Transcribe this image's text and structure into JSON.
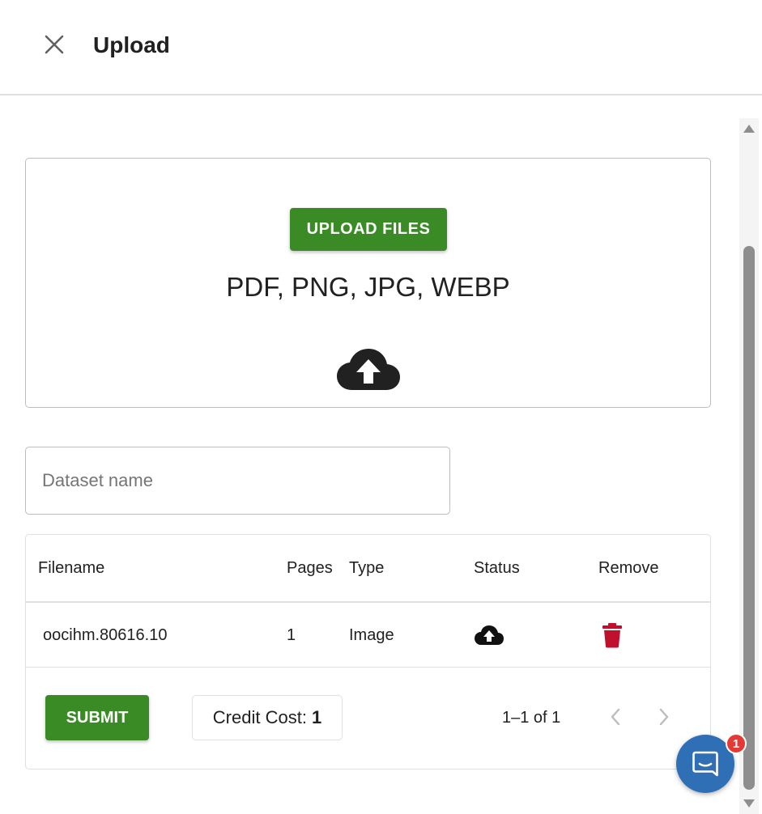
{
  "header": {
    "title": "Upload",
    "close_icon": "close-icon"
  },
  "dropzone": {
    "upload_button_label": "UPLOAD FILES",
    "formats_text": "PDF, PNG, JPG, WEBP",
    "icon": "cloud-upload-icon"
  },
  "dataset": {
    "placeholder": "Dataset name",
    "value": ""
  },
  "table": {
    "columns": [
      "Filename",
      "Pages",
      "Type",
      "Status",
      "Remove"
    ],
    "rows": [
      {
        "filename": "oocihm.80616.10",
        "pages": "1",
        "type": "Image",
        "status_icon": "cloud-upload-icon",
        "remove_icon": "trash-icon"
      }
    ]
  },
  "footer": {
    "submit_label": "SUBMIT",
    "credit_label": "Credit Cost:",
    "credit_value": "1",
    "pager_text": "1–1 of 1"
  },
  "chat": {
    "badge_count": "1",
    "icon": "chat-icon"
  },
  "colors": {
    "primary_green": "#3a8a25",
    "danger_red": "#c0102b",
    "chat_blue": "#2f6fb5",
    "badge_red": "#e53935"
  }
}
